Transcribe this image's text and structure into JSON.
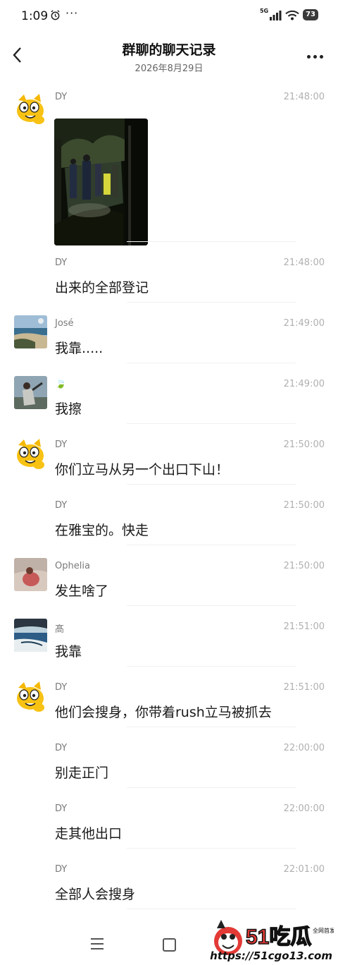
{
  "status_bar": {
    "time": "1:09",
    "more": "···",
    "network": "5G",
    "battery": "73"
  },
  "header": {
    "title": "群聊的聊天记录",
    "date": "2026年8月29日"
  },
  "messages": [
    {
      "sender": "DY",
      "time": "21:48:00",
      "text": "",
      "kind": "image",
      "avatar": "cat-avatar"
    },
    {
      "sender": "DY",
      "time": "21:48:00",
      "text": "出来的全部登记"
    },
    {
      "sender": "José",
      "time": "21:49:00",
      "text": "我靠.....",
      "avatar": "beach-avatar"
    },
    {
      "sender": "🍃",
      "time": "21:49:00",
      "text": "我擦",
      "avatar": "person-avatar"
    },
    {
      "sender": "DY",
      "time": "21:50:00",
      "text": "你们立马从另一个出口下山！",
      "avatar": "cat-avatar"
    },
    {
      "sender": "DY",
      "time": "21:50:00",
      "text": "在雅宝的。快走"
    },
    {
      "sender": "Ophelia",
      "time": "21:50:00",
      "text": "发生啥了",
      "avatar": "ophelia-avatar"
    },
    {
      "sender": "髙",
      "time": "21:51:00",
      "text": "我靠",
      "avatar": "landscape-avatar"
    },
    {
      "sender": "DY",
      "time": "21:51:00",
      "text": "他们会搜身，你带着rush立马被抓去",
      "avatar": "cat-avatar"
    },
    {
      "sender": "DY",
      "time": "22:00:00",
      "text": "别走正门"
    },
    {
      "sender": "DY",
      "time": "22:00:00",
      "text": "走其他出口"
    },
    {
      "sender": "DY",
      "time": "22:01:00",
      "text": "全部人会搜身"
    }
  ],
  "watermark": {
    "logo": "51吃瓜",
    "tag": "全网首发",
    "url": "https://51cgo13.com"
  },
  "icons": [
    "alarm-icon",
    "signal-icon",
    "wifi-icon",
    "back-icon",
    "more-icon",
    "menu-icon",
    "home-icon"
  ]
}
